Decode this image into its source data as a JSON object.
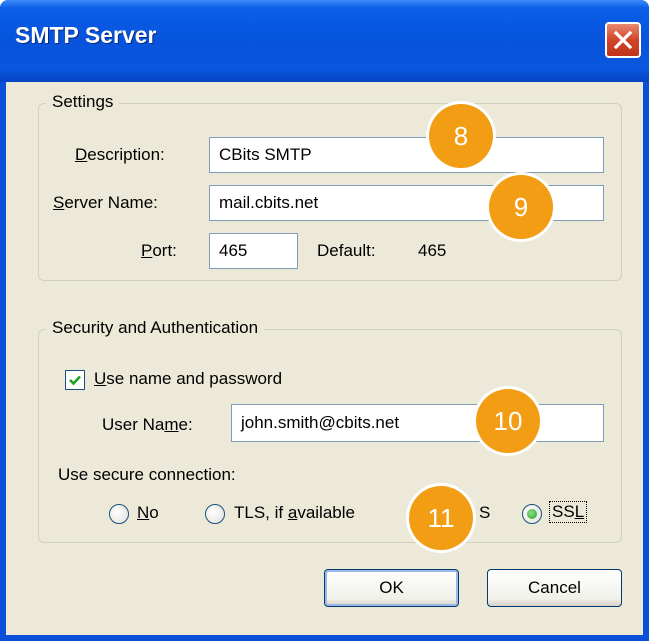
{
  "window": {
    "title": "SMTP Server"
  },
  "settings": {
    "legend": "Settings",
    "description_label_pre": "",
    "description_label_key": "D",
    "description_label_post": "escription:",
    "description_value": "CBits SMTP",
    "server_label_key": "S",
    "server_label_post": "erver Name:",
    "server_value": "mail.cbits.net",
    "port_label_key": "P",
    "port_label_post": "ort:",
    "port_value": "465",
    "default_label": "Default:",
    "default_value": "465"
  },
  "security": {
    "legend": "Security and Authentication",
    "use_name_key": "U",
    "use_name_post": "se name and password",
    "use_name_checked": true,
    "username_label_pre": "User Na",
    "username_label_key": "m",
    "username_label_post": "e:",
    "username_value": "john.smith@cbits.net",
    "secure_label": "Use secure connection:",
    "radio_no_key": "N",
    "radio_no_post": "o",
    "radio_tls_pre": "TLS, if ",
    "radio_tls_key": "a",
    "radio_tls_post": "vailable",
    "radio_tls_partial": "S",
    "radio_ssl_pre": "SS",
    "radio_ssl_key": "L",
    "selected": "SSL"
  },
  "buttons": {
    "ok": "OK",
    "cancel": "Cancel"
  },
  "badges": [
    "8",
    "9",
    "10",
    "11"
  ],
  "colors": {
    "badge": "#f39d14",
    "titlebar": "#0753dc",
    "dialog_bg": "#ece9d8"
  }
}
